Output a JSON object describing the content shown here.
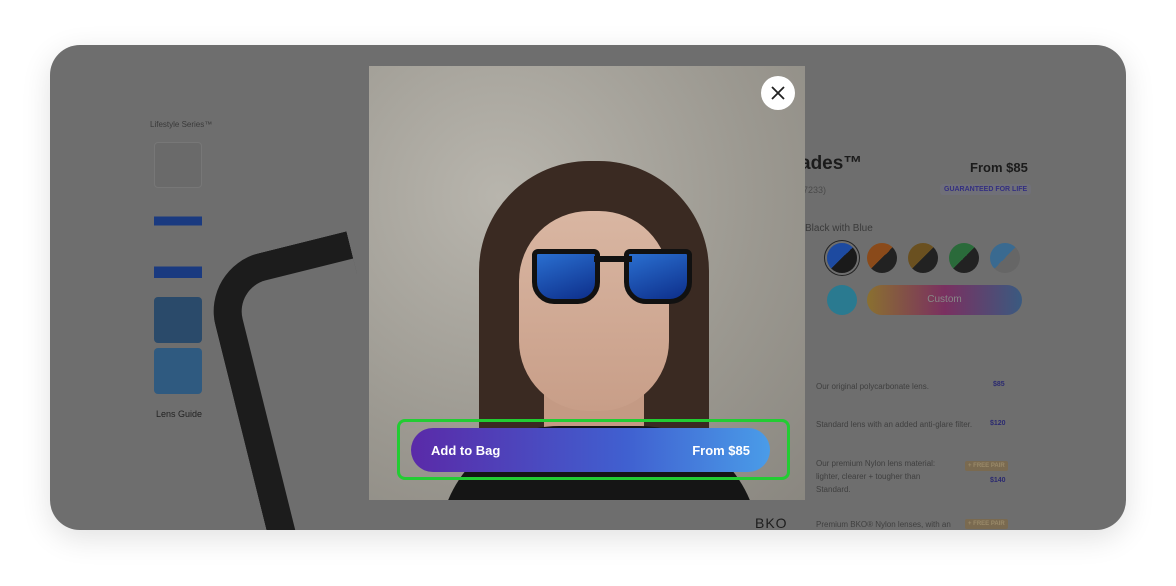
{
  "background": {
    "series_label": "Lifestyle Series™",
    "lens_guide": "Lens Guide",
    "product_title": "ades™",
    "price": "From $85",
    "reviews": "(7233)",
    "badge": "GUARANTEED FOR LIFE",
    "color_label": "Black with Blue",
    "custom_label": "Custom",
    "lens_options": [
      {
        "desc": "Our original polycarbonate lens.",
        "price": "$85"
      },
      {
        "desc": "Standard lens with an added anti-glare filter.",
        "price": "$120"
      },
      {
        "desc": "Our premium Nylon lens material: lighter, clearer + tougher than Standard.",
        "price": "$140",
        "badge": "+ FREE PAIR"
      },
      {
        "desc": "Premium BKO® Nylon lenses, with an",
        "badge": "+ FREE PAIR"
      }
    ],
    "bko_logo": "BKO"
  },
  "modal": {
    "close_icon": "close-icon",
    "add_to_bag": "Add to Bag",
    "price": "From $85",
    "colors": {
      "highlight": "#22cc33",
      "button_start": "#5a2aa8",
      "button_end": "#4a9ce8"
    }
  }
}
